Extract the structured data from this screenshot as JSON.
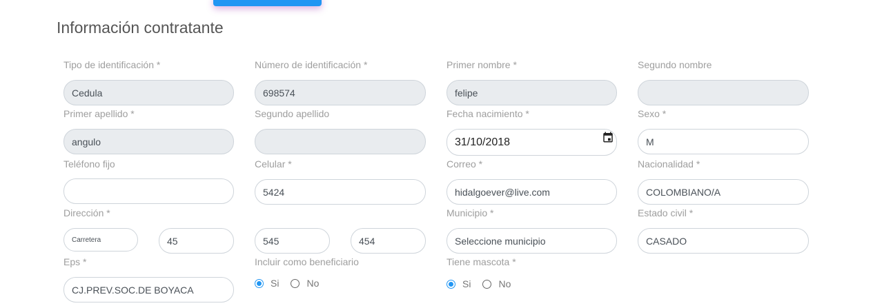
{
  "section_title": "Información contratante",
  "fields": {
    "tipo_id": {
      "label": "Tipo de identificación *",
      "value": "Cedula"
    },
    "numero_id": {
      "label": "Número de identificación *",
      "value": "698574"
    },
    "primer_nombre": {
      "label": "Primer nombre *",
      "value": "felipe"
    },
    "segundo_nombre": {
      "label": "Segundo nombre",
      "value": ""
    },
    "primer_apellido": {
      "label": "Primer apellido *",
      "value": "angulo"
    },
    "segundo_apellido": {
      "label": "Segundo apellido",
      "value": ""
    },
    "fecha_nacimiento": {
      "label": "Fecha nacimiento *",
      "value": "31/10/2018"
    },
    "sexo": {
      "label": "Sexo *",
      "value": "M"
    },
    "telefono_fijo": {
      "label": "Teléfono fijo",
      "value": ""
    },
    "celular": {
      "label": "Celular *",
      "value": "5424"
    },
    "correo": {
      "label": "Correo *",
      "value": "hidalgoever@live.com"
    },
    "nacionalidad": {
      "label": "Nacionalidad *",
      "value": "COLOMBIANO/A"
    },
    "direccion": {
      "label": "Dirección *",
      "parts": [
        "Carretera",
        "45",
        "545",
        "454"
      ]
    },
    "municipio": {
      "label": "Municipio *",
      "value": "Seleccione municipio"
    },
    "estado_civil": {
      "label": "Estado civil *",
      "value": "CASADO"
    },
    "eps": {
      "label": "Eps *",
      "value": "CJ.PREV.SOC.DE BOYACA"
    }
  },
  "radios": {
    "beneficiario": {
      "label": "Incluir como beneficiario",
      "yes": "Si",
      "no": "No",
      "selected": "Si"
    },
    "mascota": {
      "label": "Tiene mascota *",
      "yes": "Si",
      "no": "No",
      "selected": "Si"
    }
  },
  "icons": {
    "calendar": "calendar-icon"
  },
  "colors": {
    "accent": "#2196f3",
    "disabled_bg": "#e9ecef",
    "label": "#9e9e9e"
  }
}
